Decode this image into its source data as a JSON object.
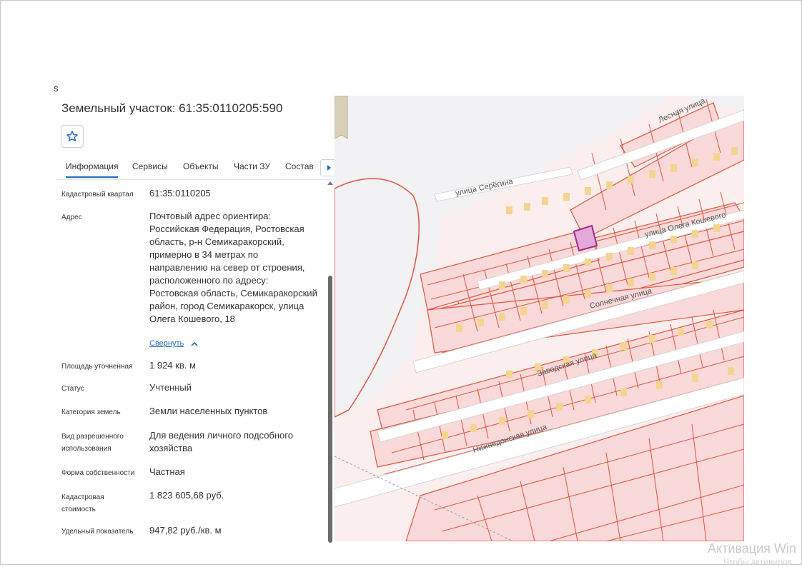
{
  "marker": "s",
  "title": "Земельный участок: 61:35:0110205:590",
  "favorite_icon": "star-icon",
  "tabs": [
    "Информация",
    "Сервисы",
    "Объекты",
    "Части ЗУ",
    "Состав"
  ],
  "active_tab": "Информация",
  "rows": {
    "quarter": {
      "label": "Кадастровый квартал",
      "value": "61:35:0110205"
    },
    "address": {
      "label": "Адрес",
      "value": "Почтовый адрес ориентира: Российская Федерация, Ростовская область, р-н Семикаракорский, примерно в 34 метрах по направлению на север от строения, расположенного по адресу: Ростовская область, Семикаракорский район, город Семикаракорск, улица Олега Кошевого, 18"
    },
    "collapse": "Свернуть",
    "area": {
      "label": "Площадь уточненная",
      "value": "1 924 кв. м"
    },
    "status": {
      "label": "Статус",
      "value": "Учтенный"
    },
    "category": {
      "label": "Категория земель",
      "value": "Земли населенных пунктов"
    },
    "use": {
      "label": "Вид разрешенного использования",
      "value": "Для ведения личного подсобного хозяйства"
    },
    "ownership": {
      "label": "Форма собственности",
      "value": "Частная"
    },
    "cost": {
      "label": "Кадастровая стоимость",
      "value": "1 823 605,68 руб."
    },
    "specific": {
      "label": "Удельный показатель",
      "value": "947,82 руб./кв. м"
    }
  },
  "map": {
    "streets": {
      "seregina": "улица Серёгина",
      "lesnaya": "Лесная улица",
      "koshevogo": "улица Олега Кошевого",
      "solnechnaya": "Солнечная улица",
      "zavodskaya": "Заводская улица",
      "nizhnedonskaya": "Нижнедонская улица"
    },
    "colors": {
      "parcel_line": "#e0553f",
      "parcel_fill": "#f9d9d9",
      "building": "#f3d591",
      "selected": "#c02f9f",
      "road": "#ffffff",
      "green": "#f1f0ef"
    }
  },
  "watermark": {
    "line1": "Активация Win",
    "line2": "Чтобы активиров"
  }
}
